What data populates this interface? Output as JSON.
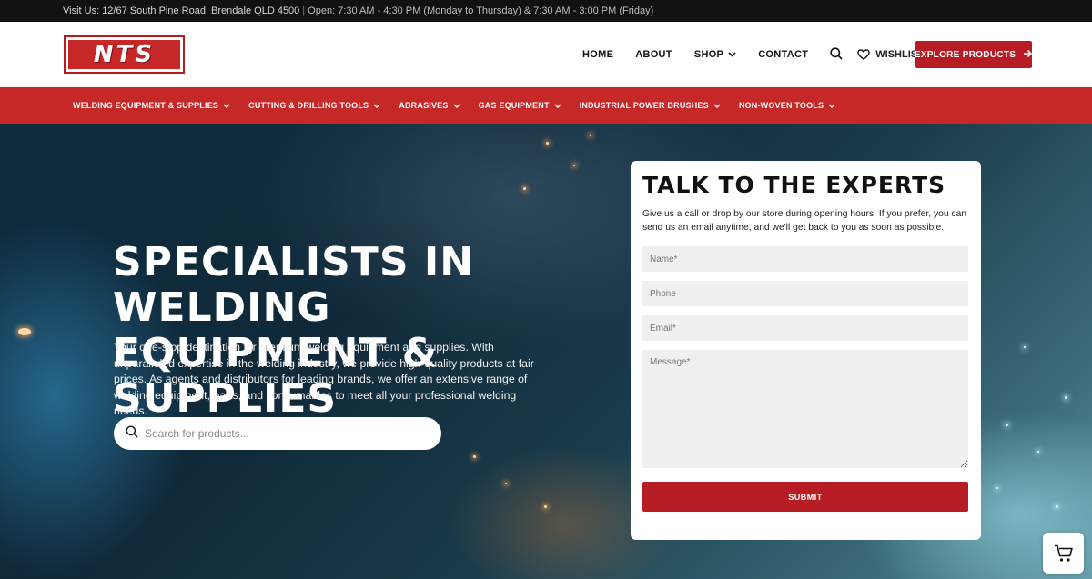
{
  "topbar": {
    "address": "Visit Us: 12/67 South Pine Road, Brendale QLD 4500",
    "hours": "Open: 7:30 AM - 4:30 PM (Monday to Thursday) & 7:30 AM - 3:00 PM (Friday)"
  },
  "brand": {
    "logo_text": "NTS"
  },
  "nav": {
    "home": "HOME",
    "about": "ABOUT",
    "shop": "SHOP",
    "contact": "CONTACT",
    "wishlist": "WISHLIST",
    "explore": "EXPLORE PRODUCTS"
  },
  "categories": [
    {
      "label": "WELDING EQUIPMENT & SUPPLIES"
    },
    {
      "label": "CUTTING & DRILLING TOOLS"
    },
    {
      "label": "ABRASIVES"
    },
    {
      "label": "GAS EQUIPMENT"
    },
    {
      "label": "INDUSTRIAL POWER BRUSHES"
    },
    {
      "label": "NON-WOVEN TOOLS"
    }
  ],
  "hero": {
    "title": "SPECIALISTS IN WELDING EQUIPMENT & SUPPLIES",
    "description": "Your one-stop destination for premium welding equipment and supplies. With unparalleled expertise in the welding industry, we provide high-quality products at fair prices. As agents and distributors for leading brands, we offer an extensive range of welding equipment, parts, and consumables to meet all your professional welding needs.",
    "search_placeholder": "Search for products..."
  },
  "contact_form": {
    "title": "TALK TO THE EXPERTS",
    "description": "Give us a call or drop by our store during opening hours. If you prefer, you can send us an email anytime, and we'll get back to you as soon as possible.",
    "name_placeholder": "Name*",
    "phone_placeholder": "Phone",
    "email_placeholder": "Email*",
    "message_placeholder": "Message*",
    "submit_label": "SUBMIT"
  },
  "colors": {
    "brand_red": "#c62828",
    "button_red": "#b71c24",
    "topbar": "#111111"
  }
}
